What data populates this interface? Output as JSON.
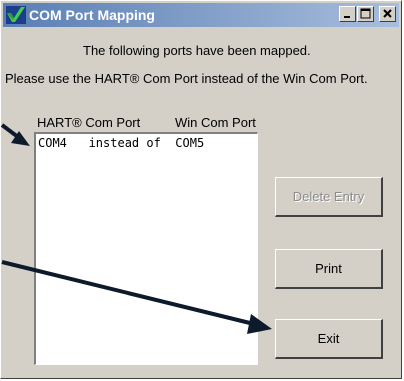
{
  "window": {
    "title": "COM Port Mapping"
  },
  "message": {
    "line1": "The following ports have been mapped.",
    "line2": "Please use the HART® Com Port instead of the Win Com Port."
  },
  "list": {
    "headers": {
      "hart": "HART® Com Port",
      "win": "Win Com Port"
    },
    "rows": [
      {
        "text": "COM4   instead of  COM5"
      }
    ]
  },
  "buttons": {
    "delete_label": "Delete Entry",
    "print_label": "Print",
    "exit_label": "Exit"
  },
  "colors": {
    "titlebar_start": "#5a7fb4",
    "face": "#d4d0c8",
    "arrow": "#0d1a2b"
  },
  "icons": {
    "app": "checkmark-logo-icon",
    "minimize": "minimize-icon",
    "maximize": "maximize-icon",
    "close": "close-icon"
  }
}
